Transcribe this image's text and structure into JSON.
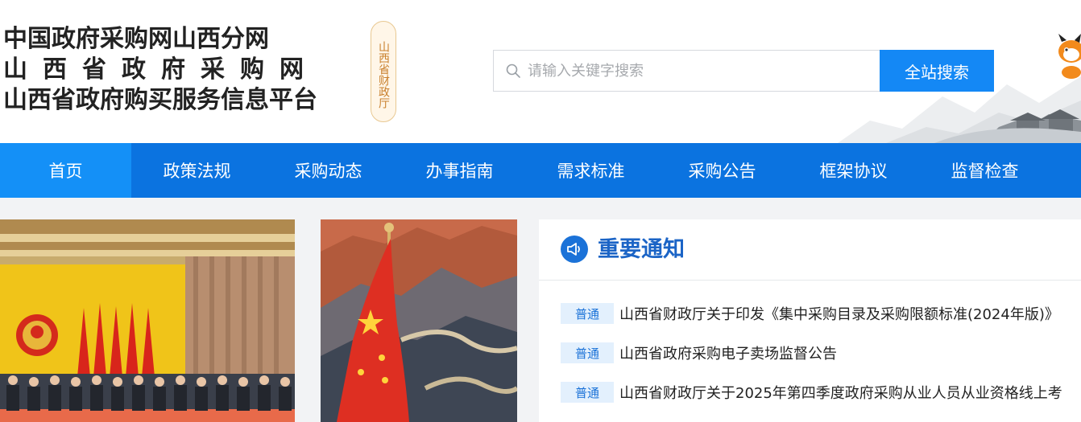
{
  "header": {
    "title_lines": [
      "中国政府采购网山西分网",
      "山西省政府采购网",
      "山西省政府购买服务信息平台"
    ],
    "dept_badge": "山西省财政厅"
  },
  "search": {
    "placeholder": "请输入关键字搜索",
    "value": "",
    "button_label": "全站搜索"
  },
  "nav": {
    "active_index": 0,
    "items": [
      "首页",
      "政策法规",
      "采购动态",
      "办事指南",
      "需求标准",
      "采购公告",
      "框架协议",
      "监督检查"
    ]
  },
  "notices": {
    "title": "重要通知",
    "items": [
      {
        "tag": "普通",
        "text": "山西省财政厅关于印发《集中采购目录及采购限额标准(2024年版)》"
      },
      {
        "tag": "普通",
        "text": "山西省政府采购电子卖场监督公告"
      },
      {
        "tag": "普通",
        "text": "山西省财政厅关于2025年第四季度政府采购从业人员从业资格线上考"
      }
    ]
  },
  "colors": {
    "nav_bg": "#0b73e0",
    "nav_active": "#1490f7",
    "accent": "#1488f5",
    "notice_title": "#1b64c6",
    "tag_bg": "#e3f0fd"
  },
  "icons": {
    "search": "search-icon",
    "notice": "megaphone-icon"
  }
}
